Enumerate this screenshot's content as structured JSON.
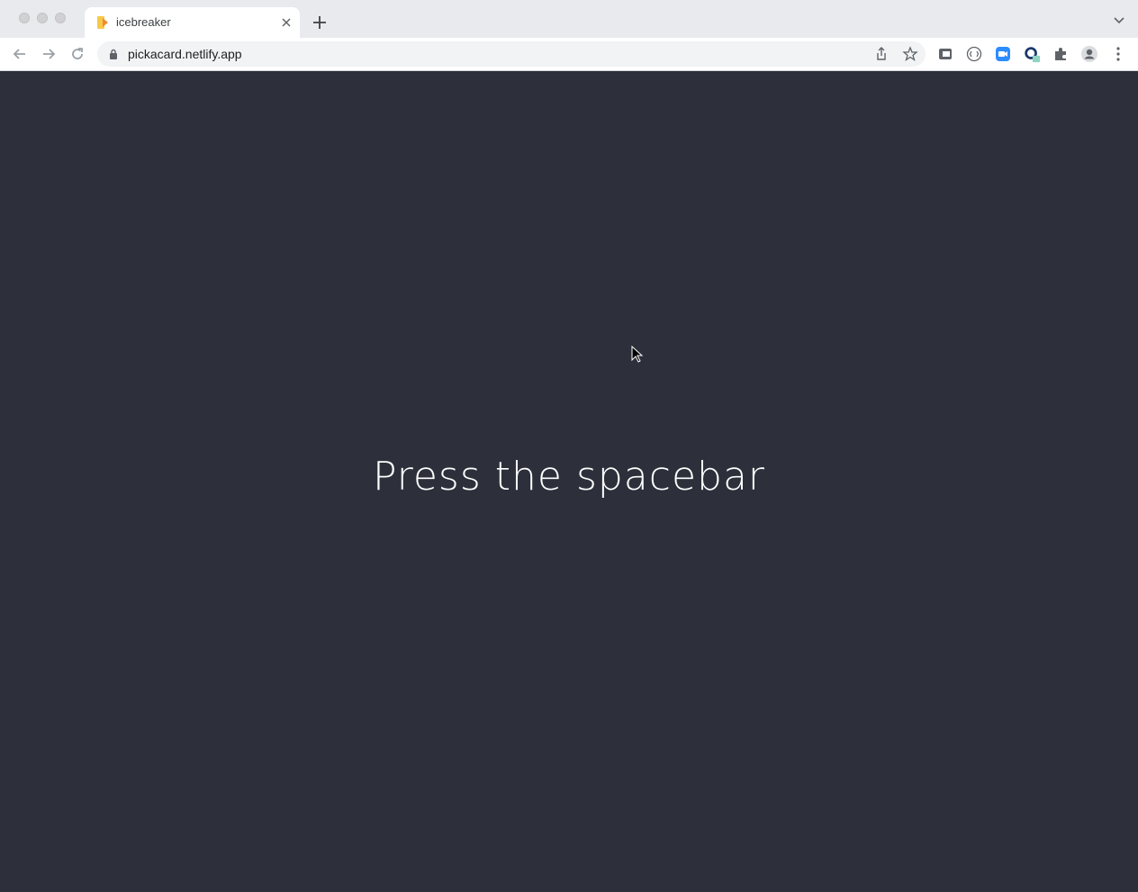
{
  "browser": {
    "tab": {
      "title": "icebreaker"
    },
    "address": {
      "url": "pickacard.netlify.app"
    }
  },
  "page": {
    "message": "Press the spacebar"
  },
  "colors": {
    "background": "#2d303b",
    "text": "#ffffff",
    "chrome": "#e8eaed"
  },
  "icons": [
    "back-icon",
    "forward-icon",
    "reload-icon",
    "lock-icon",
    "share-icon",
    "star-icon",
    "extension-icon",
    "profile-icon",
    "menu-icon"
  ]
}
